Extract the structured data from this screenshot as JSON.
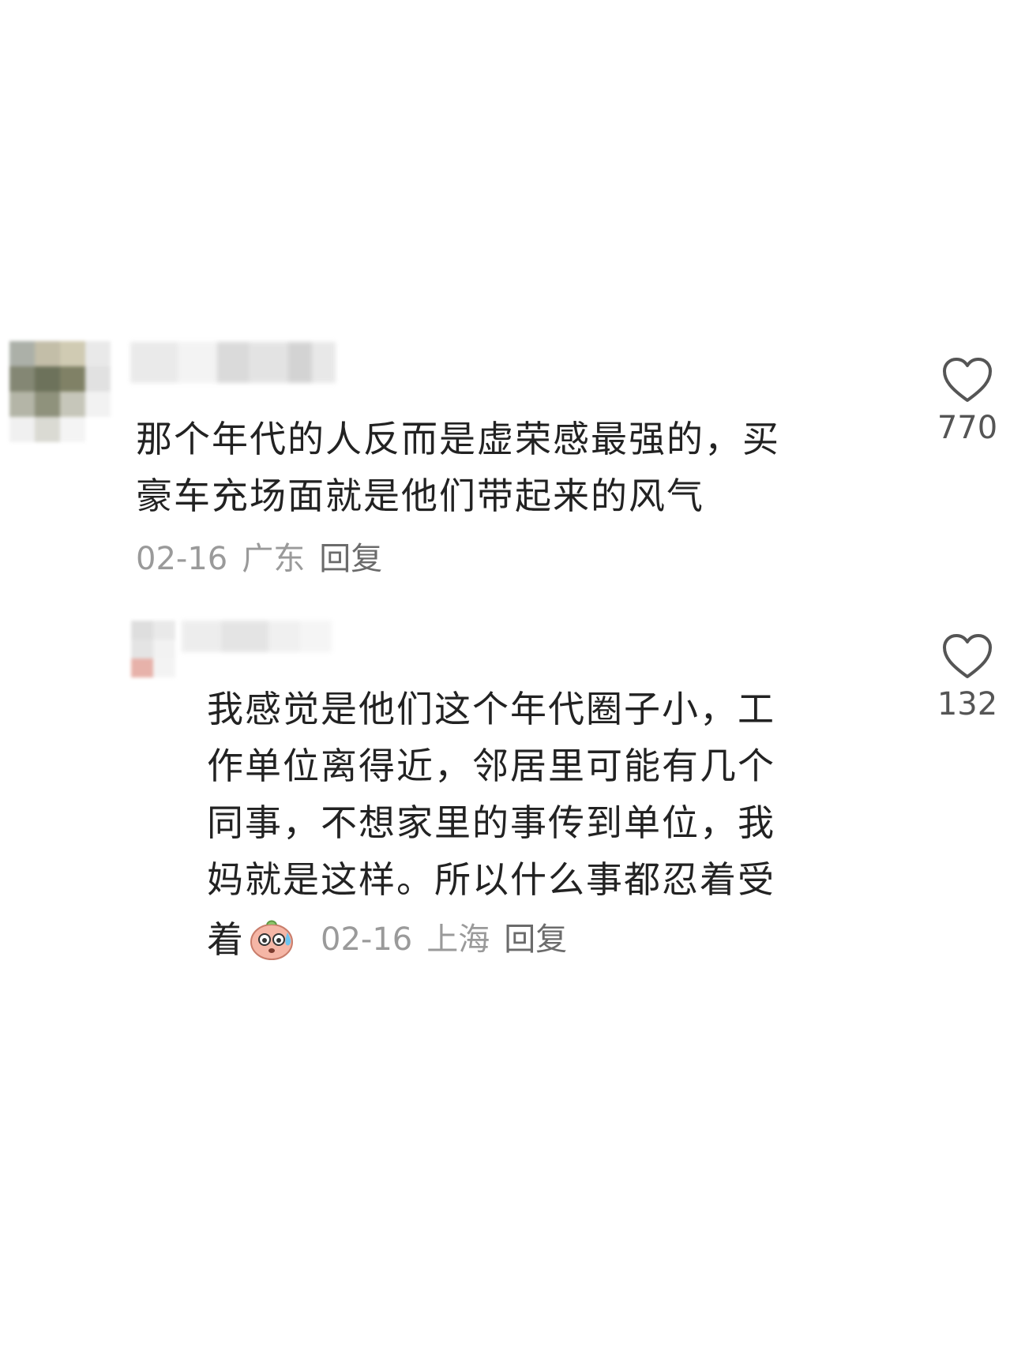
{
  "comments": [
    {
      "text": "那个年代的人反而是虚荣感最强的，买\n豪车充场面就是他们带起来的风气",
      "date": "02-16",
      "location": "广东",
      "reply_label": "回复",
      "likes": "770"
    },
    {
      "text": "我感觉是他们这个年代圈子小，工\n作单位离得近，邻居里可能有几个\n同事，不想家里的事传到单位，我\n妈就是这样。所以什么事都忍着受",
      "text_tail": "着",
      "date": "02-16",
      "location": "上海",
      "reply_label": "回复",
      "likes": "132"
    }
  ],
  "icons": {
    "like": "heart-outline-icon",
    "emoji": "sweating-face-emoji-icon"
  },
  "colors": {
    "text": "#222222",
    "meta": "#9a9a9a",
    "reply_link": "#6b6b6b",
    "like_count": "#555555",
    "background": "#ffffff"
  }
}
